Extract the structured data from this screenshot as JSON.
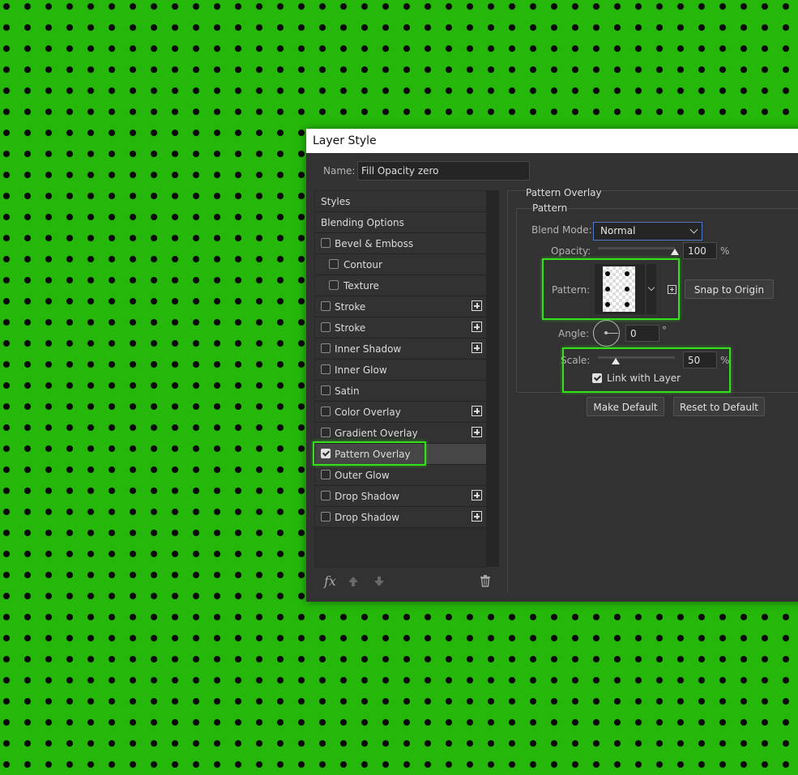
{
  "dialog": {
    "title": "Layer Style"
  },
  "name_field": {
    "label": "Name:",
    "value": "Fill Opacity zero"
  },
  "styles_list": [
    {
      "label": "Styles",
      "checkbox": false,
      "checked": false,
      "indent": 0,
      "plus": false,
      "selected": false
    },
    {
      "label": "Blending Options",
      "checkbox": false,
      "checked": false,
      "indent": 0,
      "plus": false,
      "selected": false
    },
    {
      "label": "Bevel & Emboss",
      "checkbox": true,
      "checked": false,
      "indent": 0,
      "plus": false,
      "selected": false
    },
    {
      "label": "Contour",
      "checkbox": true,
      "checked": false,
      "indent": 1,
      "plus": false,
      "selected": false
    },
    {
      "label": "Texture",
      "checkbox": true,
      "checked": false,
      "indent": 1,
      "plus": false,
      "selected": false
    },
    {
      "label": "Stroke",
      "checkbox": true,
      "checked": false,
      "indent": 0,
      "plus": true,
      "selected": false
    },
    {
      "label": "Stroke",
      "checkbox": true,
      "checked": false,
      "indent": 0,
      "plus": true,
      "selected": false
    },
    {
      "label": "Inner Shadow",
      "checkbox": true,
      "checked": false,
      "indent": 0,
      "plus": true,
      "selected": false
    },
    {
      "label": "Inner Glow",
      "checkbox": true,
      "checked": false,
      "indent": 0,
      "plus": false,
      "selected": false
    },
    {
      "label": "Satin",
      "checkbox": true,
      "checked": false,
      "indent": 0,
      "plus": false,
      "selected": false
    },
    {
      "label": "Color Overlay",
      "checkbox": true,
      "checked": false,
      "indent": 0,
      "plus": true,
      "selected": false
    },
    {
      "label": "Gradient Overlay",
      "checkbox": true,
      "checked": false,
      "indent": 0,
      "plus": true,
      "selected": false
    },
    {
      "label": "Pattern Overlay",
      "checkbox": true,
      "checked": true,
      "indent": 0,
      "plus": false,
      "selected": true
    },
    {
      "label": "Outer Glow",
      "checkbox": true,
      "checked": false,
      "indent": 0,
      "plus": false,
      "selected": false
    },
    {
      "label": "Drop Shadow",
      "checkbox": true,
      "checked": false,
      "indent": 0,
      "plus": true,
      "selected": false
    },
    {
      "label": "Drop Shadow",
      "checkbox": true,
      "checked": false,
      "indent": 0,
      "plus": true,
      "selected": false
    }
  ],
  "footer": {
    "fx_label": "fx",
    "icons": [
      "fx-icon",
      "move-up-icon",
      "move-down-icon",
      "trash-icon"
    ]
  },
  "pattern_overlay": {
    "section_title": "Pattern Overlay",
    "group_title": "Pattern",
    "blend_mode": {
      "label": "Blend Mode:",
      "value": "Normal"
    },
    "opacity": {
      "label": "Opacity:",
      "value": "100",
      "unit": "%",
      "level": 1.0
    },
    "pattern": {
      "label": "Pattern:",
      "snap_button": "Snap to Origin"
    },
    "angle": {
      "label": "Angle:",
      "value": "0",
      "unit": "°"
    },
    "scale": {
      "label": "Scale:",
      "value": "50",
      "unit": "%",
      "level": 0.23
    },
    "link_with_layer": {
      "label": "Link with Layer",
      "checked": true
    },
    "make_default": "Make Default",
    "reset_default": "Reset to Default"
  },
  "colors": {
    "canvas_green": "#25b80a",
    "highlight_green": "#34e01a",
    "dialog_bg": "#323232",
    "accent_blue": "#5078c8"
  }
}
